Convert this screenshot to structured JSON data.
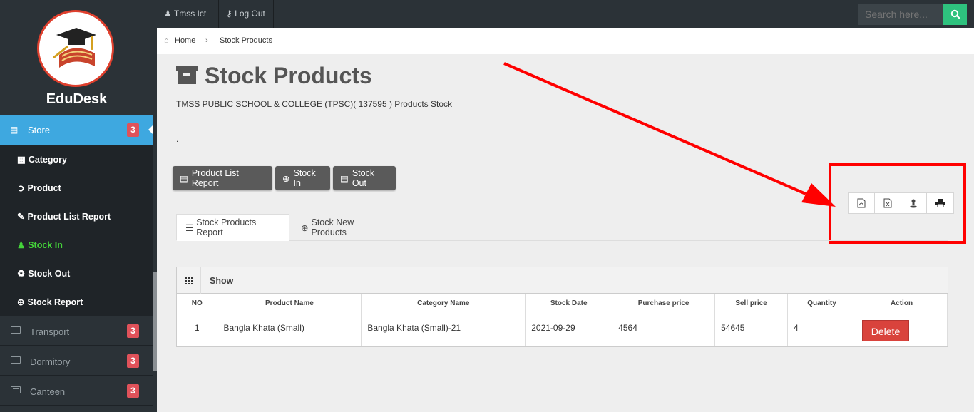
{
  "sidebar": {
    "brand": "EduDesk",
    "active_module": {
      "label": "Store",
      "badge": "3"
    },
    "sub_items": [
      {
        "label": "Category",
        "icon": "grid-icon"
      },
      {
        "label": "Product",
        "icon": "product-icon"
      },
      {
        "label": "Product List Report",
        "icon": "report-edit-icon"
      },
      {
        "label": "Stock In",
        "icon": "user-plus-icon",
        "active": true
      },
      {
        "label": "Stock Out",
        "icon": "recycle-icon"
      },
      {
        "label": "Stock Report",
        "icon": "plus-circle-icon"
      }
    ],
    "modules": [
      {
        "label": "Transport",
        "badge": "3"
      },
      {
        "label": "Dormitory",
        "badge": "3"
      },
      {
        "label": "Canteen",
        "badge": "3"
      }
    ]
  },
  "topbar": {
    "user": "Tmss Ict",
    "logout": "Log Out",
    "search_placeholder": "Search here..."
  },
  "breadcrumb": {
    "home": "Home",
    "current": "Stock Products"
  },
  "page": {
    "title": "Stock Products",
    "subtitle": "TMSS PUBLIC SCHOOL & COLLEGE (TPSC)( 137595 ) Products Stock",
    "dot": "."
  },
  "actions": {
    "product_list_report": "Product List Report",
    "stock_in": "Stock In",
    "stock_out": "Stock Out"
  },
  "export_tools": [
    "pdf-icon",
    "excel-icon",
    "download-icon",
    "print-icon"
  ],
  "tabs": {
    "report": "Stock Products Report",
    "new": "Stock New Products"
  },
  "table": {
    "show_label": "Show",
    "headers": [
      "NO",
      "Product Name",
      "Category Name",
      "Stock Date",
      "Purchase price",
      "Sell price",
      "Quantity",
      "Action"
    ],
    "rows": [
      {
        "no": "1",
        "product": "Bangla Khata (Small)",
        "category": "Bangla Khata (Small)-21",
        "date": "2021-09-29",
        "purchase": "4564",
        "sell": "54645",
        "qty": "4",
        "action": "Delete"
      }
    ]
  },
  "colors": {
    "accent": "#3ea8e0",
    "success": "#2ec27e",
    "danger": "#d9433c",
    "annotation": "#ff0000"
  }
}
